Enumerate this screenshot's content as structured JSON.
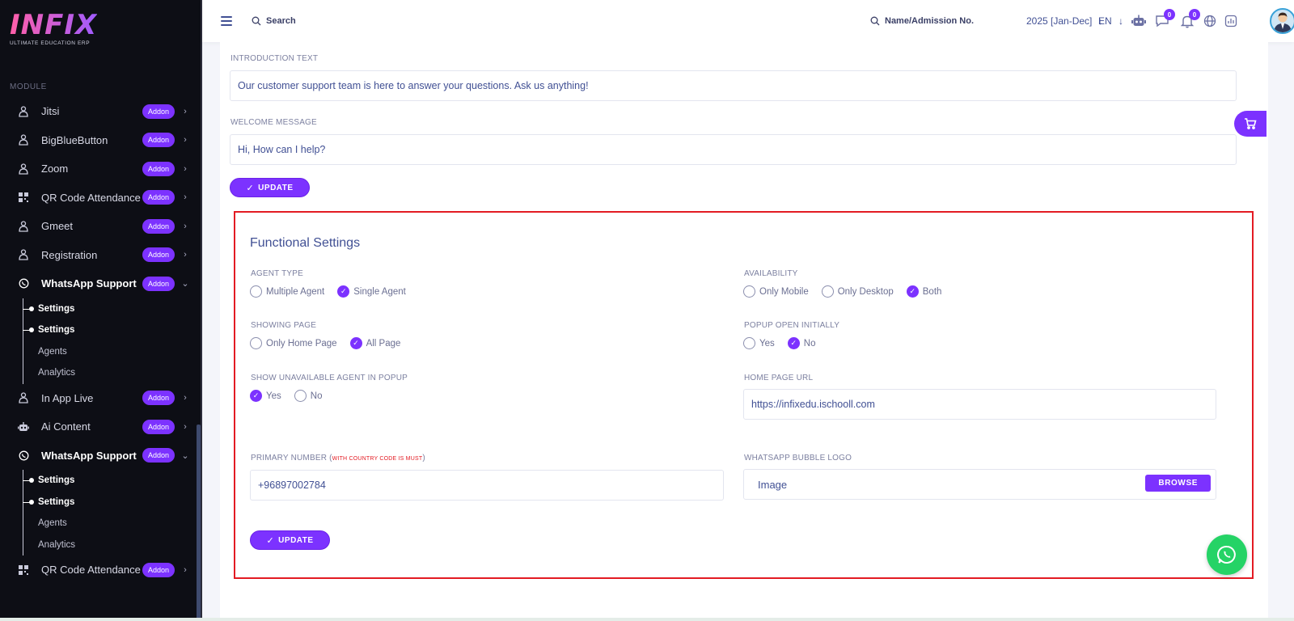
{
  "brand": {
    "logo_text": "INFIX",
    "tagline": "ULTIMATE EDUCATION ERP"
  },
  "sidebar": {
    "section_label": "MODULE",
    "addon_label": "Addon",
    "items": [
      {
        "label": "Jitsi",
        "icon": "zoom-icon"
      },
      {
        "label": "BigBlueButton",
        "icon": "zoom-icon"
      },
      {
        "label": "Zoom",
        "icon": "zoom-icon"
      },
      {
        "label": "QR Code Attendance",
        "icon": "qr-icon"
      },
      {
        "label": "Gmeet",
        "icon": "zoom-icon"
      },
      {
        "label": "Registration",
        "icon": "zoom-icon"
      },
      {
        "label": "WhatsApp Support",
        "icon": "whatsapp-icon"
      },
      {
        "label": "In App Live",
        "icon": "zoom-icon"
      },
      {
        "label": "Ai Content",
        "icon": "robot-icon"
      },
      {
        "label": "WhatsApp Support",
        "icon": "whatsapp-icon"
      },
      {
        "label": "QR Code Attendance",
        "icon": "qr-icon"
      }
    ],
    "sub_a": [
      "Settings",
      "Settings",
      "Agents",
      "Analytics"
    ],
    "sub_b": [
      "Settings",
      "Settings",
      "Agents",
      "Analytics"
    ]
  },
  "topbar": {
    "search_label": "Search",
    "name_search_label": "Name/Admission No.",
    "year": "2025 [Jan-Dec]",
    "language": "EN",
    "chat_badge": "0",
    "notif_badge": "0"
  },
  "intro": {
    "intro_label": "INTRODUCTION TEXT",
    "intro_value": "Our customer support team is here to answer your questions. Ask us anything!",
    "welcome_label": "WELCOME MESSAGE",
    "welcome_value": "Hi, How can I help?",
    "update_label": "UPDATE"
  },
  "functional": {
    "title": "Functional Settings",
    "agent_type_label": "AGENT TYPE",
    "agent_type_options": [
      "Multiple Agent",
      "Single Agent"
    ],
    "agent_type_selected": 1,
    "availability_label": "AVAILABILITY",
    "availability_options": [
      "Only Mobile",
      "Only Desktop",
      "Both"
    ],
    "availability_selected": 2,
    "showing_page_label": "SHOWING PAGE",
    "showing_page_options": [
      "Only Home Page",
      "All Page"
    ],
    "showing_page_selected": 1,
    "popup_label": "POPUP OPEN INITIALLY",
    "popup_options": [
      "Yes",
      "No"
    ],
    "popup_selected": 1,
    "unavailable_label": "SHOW UNAVAILABLE AGENT IN POPUP",
    "unavailable_options": [
      "Yes",
      "No"
    ],
    "unavailable_selected": 0,
    "home_url_label": "HOME PAGE URL",
    "home_url_value": "https://infixedu.ischooll.com",
    "primary_number_label": "PRIMARY NUMBER (",
    "primary_number_note": "WITH COUNTRY CODE IS MUST",
    "primary_number_close": ")",
    "primary_number_value": "+96897002784",
    "bubble_logo_label": "WHATSAPP BUBBLE LOGO",
    "bubble_logo_placeholder": "Image",
    "browse_label": "BROWSE",
    "update_label": "UPDATE"
  },
  "colors": {
    "accent": "#7c32ff",
    "text": "#415094",
    "highlight_border": "#e31b23",
    "whatsapp": "#25d366"
  }
}
